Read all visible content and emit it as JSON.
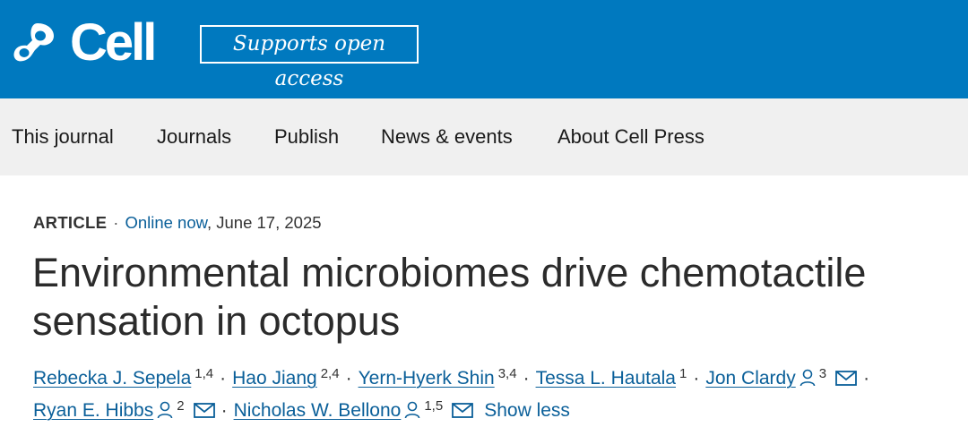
{
  "header": {
    "brand": "Cell",
    "badge": "Supports open access",
    "colors": {
      "brand_blue": "#0079bf",
      "nav_bg": "#f0f0f0",
      "link": "#0a5f99"
    }
  },
  "nav": {
    "items": [
      "This journal",
      "Journals",
      "Publish",
      "News & events",
      "About Cell Press"
    ]
  },
  "article": {
    "type": "ARTICLE",
    "status": "Online now",
    "date": ", June 17, 2025",
    "title": "Environmental microbiomes drive chemotactile sensation in octopus",
    "authors": [
      {
        "name": "Rebecka J. Sepela",
        "aff": "1,4"
      },
      {
        "name": "Hao Jiang",
        "aff": "2,4"
      },
      {
        "name": "Yern-Hyerk Shin",
        "aff": "3,4"
      },
      {
        "name": "Tessa L. Hautala",
        "aff": "1"
      },
      {
        "name": "Jon Clardy",
        "aff": "3"
      },
      {
        "name": "Ryan E. Hibbs",
        "aff": "2"
      },
      {
        "name": "Nicholas W. Bellono",
        "aff": "1,5"
      }
    ],
    "show_less": "Show less",
    "icons": {
      "person": "person-icon",
      "email": "email-icon"
    }
  }
}
